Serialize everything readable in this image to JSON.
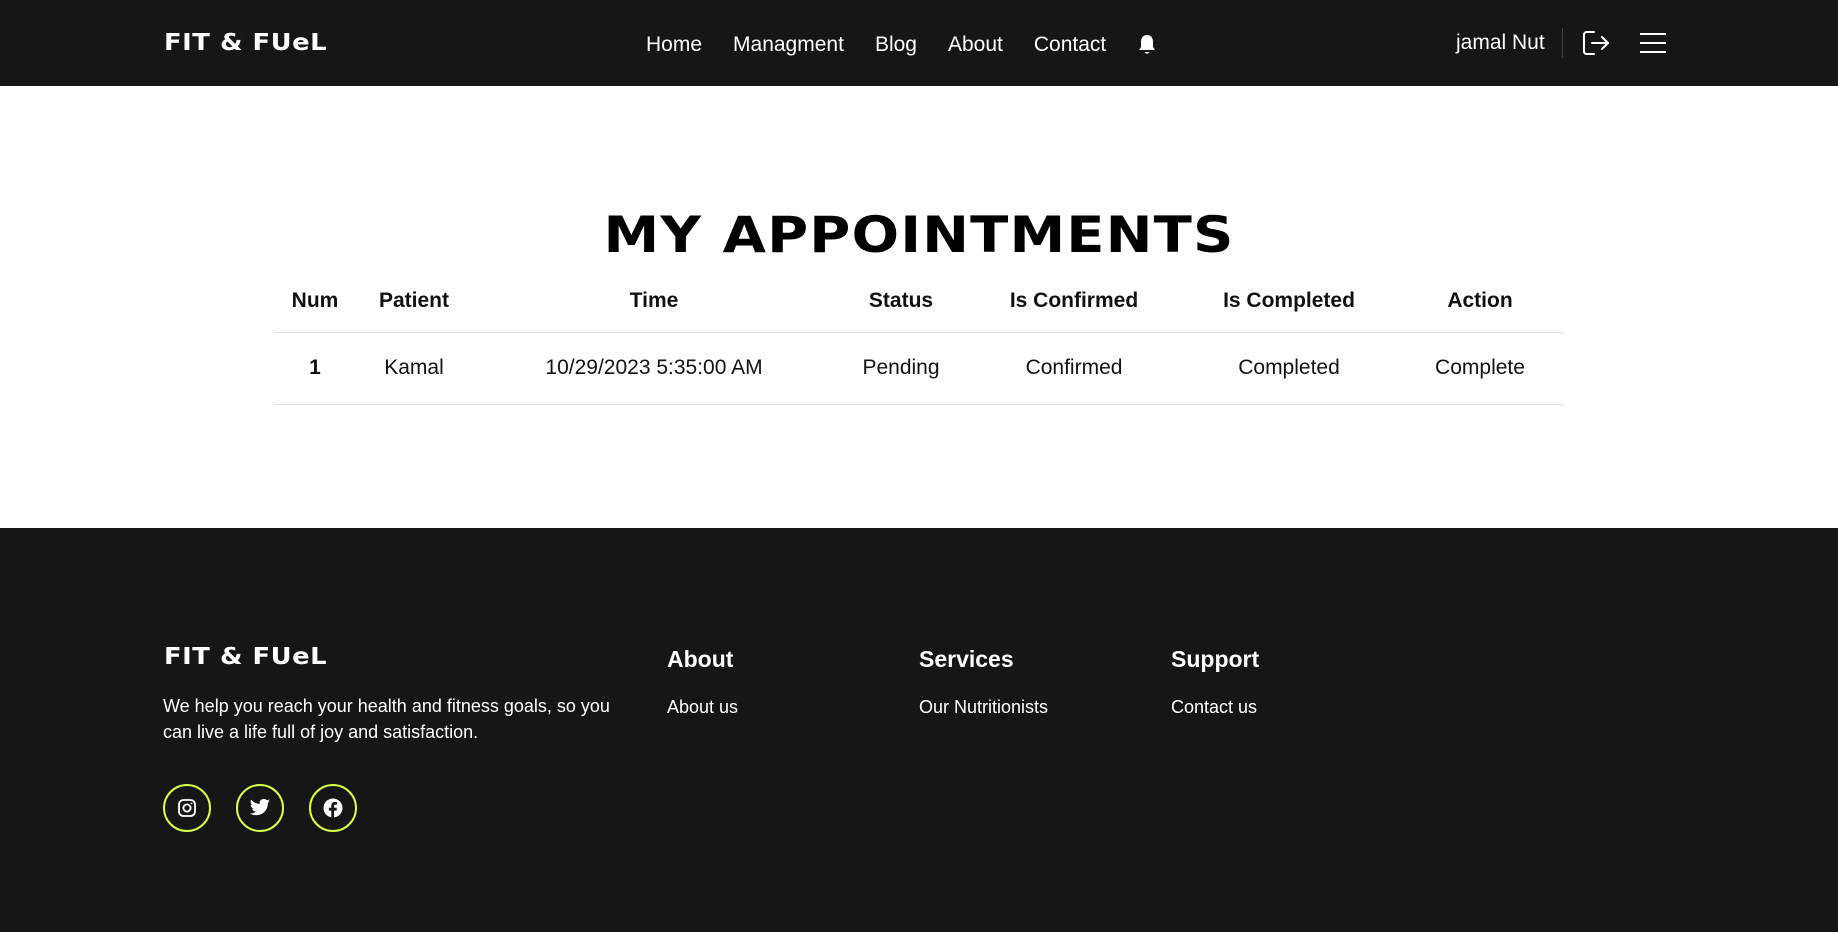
{
  "header": {
    "logo": "FIT & FUeL",
    "nav": {
      "home": "Home",
      "management": "Managment",
      "blog": "Blog",
      "about": "About",
      "contact": "Contact"
    },
    "user_name": "jamal Nut"
  },
  "main": {
    "title": "MY APPOINTMENTS",
    "columns": [
      "Num",
      "Patient",
      "Time",
      "Status",
      "Is Confirmed",
      "Is Completed",
      "Action"
    ],
    "rows": [
      {
        "num": "1",
        "patient": "Kamal",
        "time": "10/29/2023 5:35:00 AM",
        "status": "Pending",
        "is_confirmed": "Confirmed",
        "is_completed": "Completed",
        "action": "Complete"
      }
    ]
  },
  "footer": {
    "logo": "FIT & FUeL",
    "description": "We help you reach your health and fitness goals, so you can live a life full of joy and satisfaction.",
    "columns": [
      {
        "heading": "About",
        "link": "About us"
      },
      {
        "heading": "Services",
        "link": "Our Nutritionists"
      },
      {
        "heading": "Support",
        "link": "Contact us"
      }
    ],
    "socials": [
      "instagram-icon",
      "twitter-icon",
      "facebook-icon"
    ]
  },
  "colors": {
    "dark_bg": "#161616",
    "accent": "#d8ff4a",
    "status_green": "#1f7a1f"
  }
}
